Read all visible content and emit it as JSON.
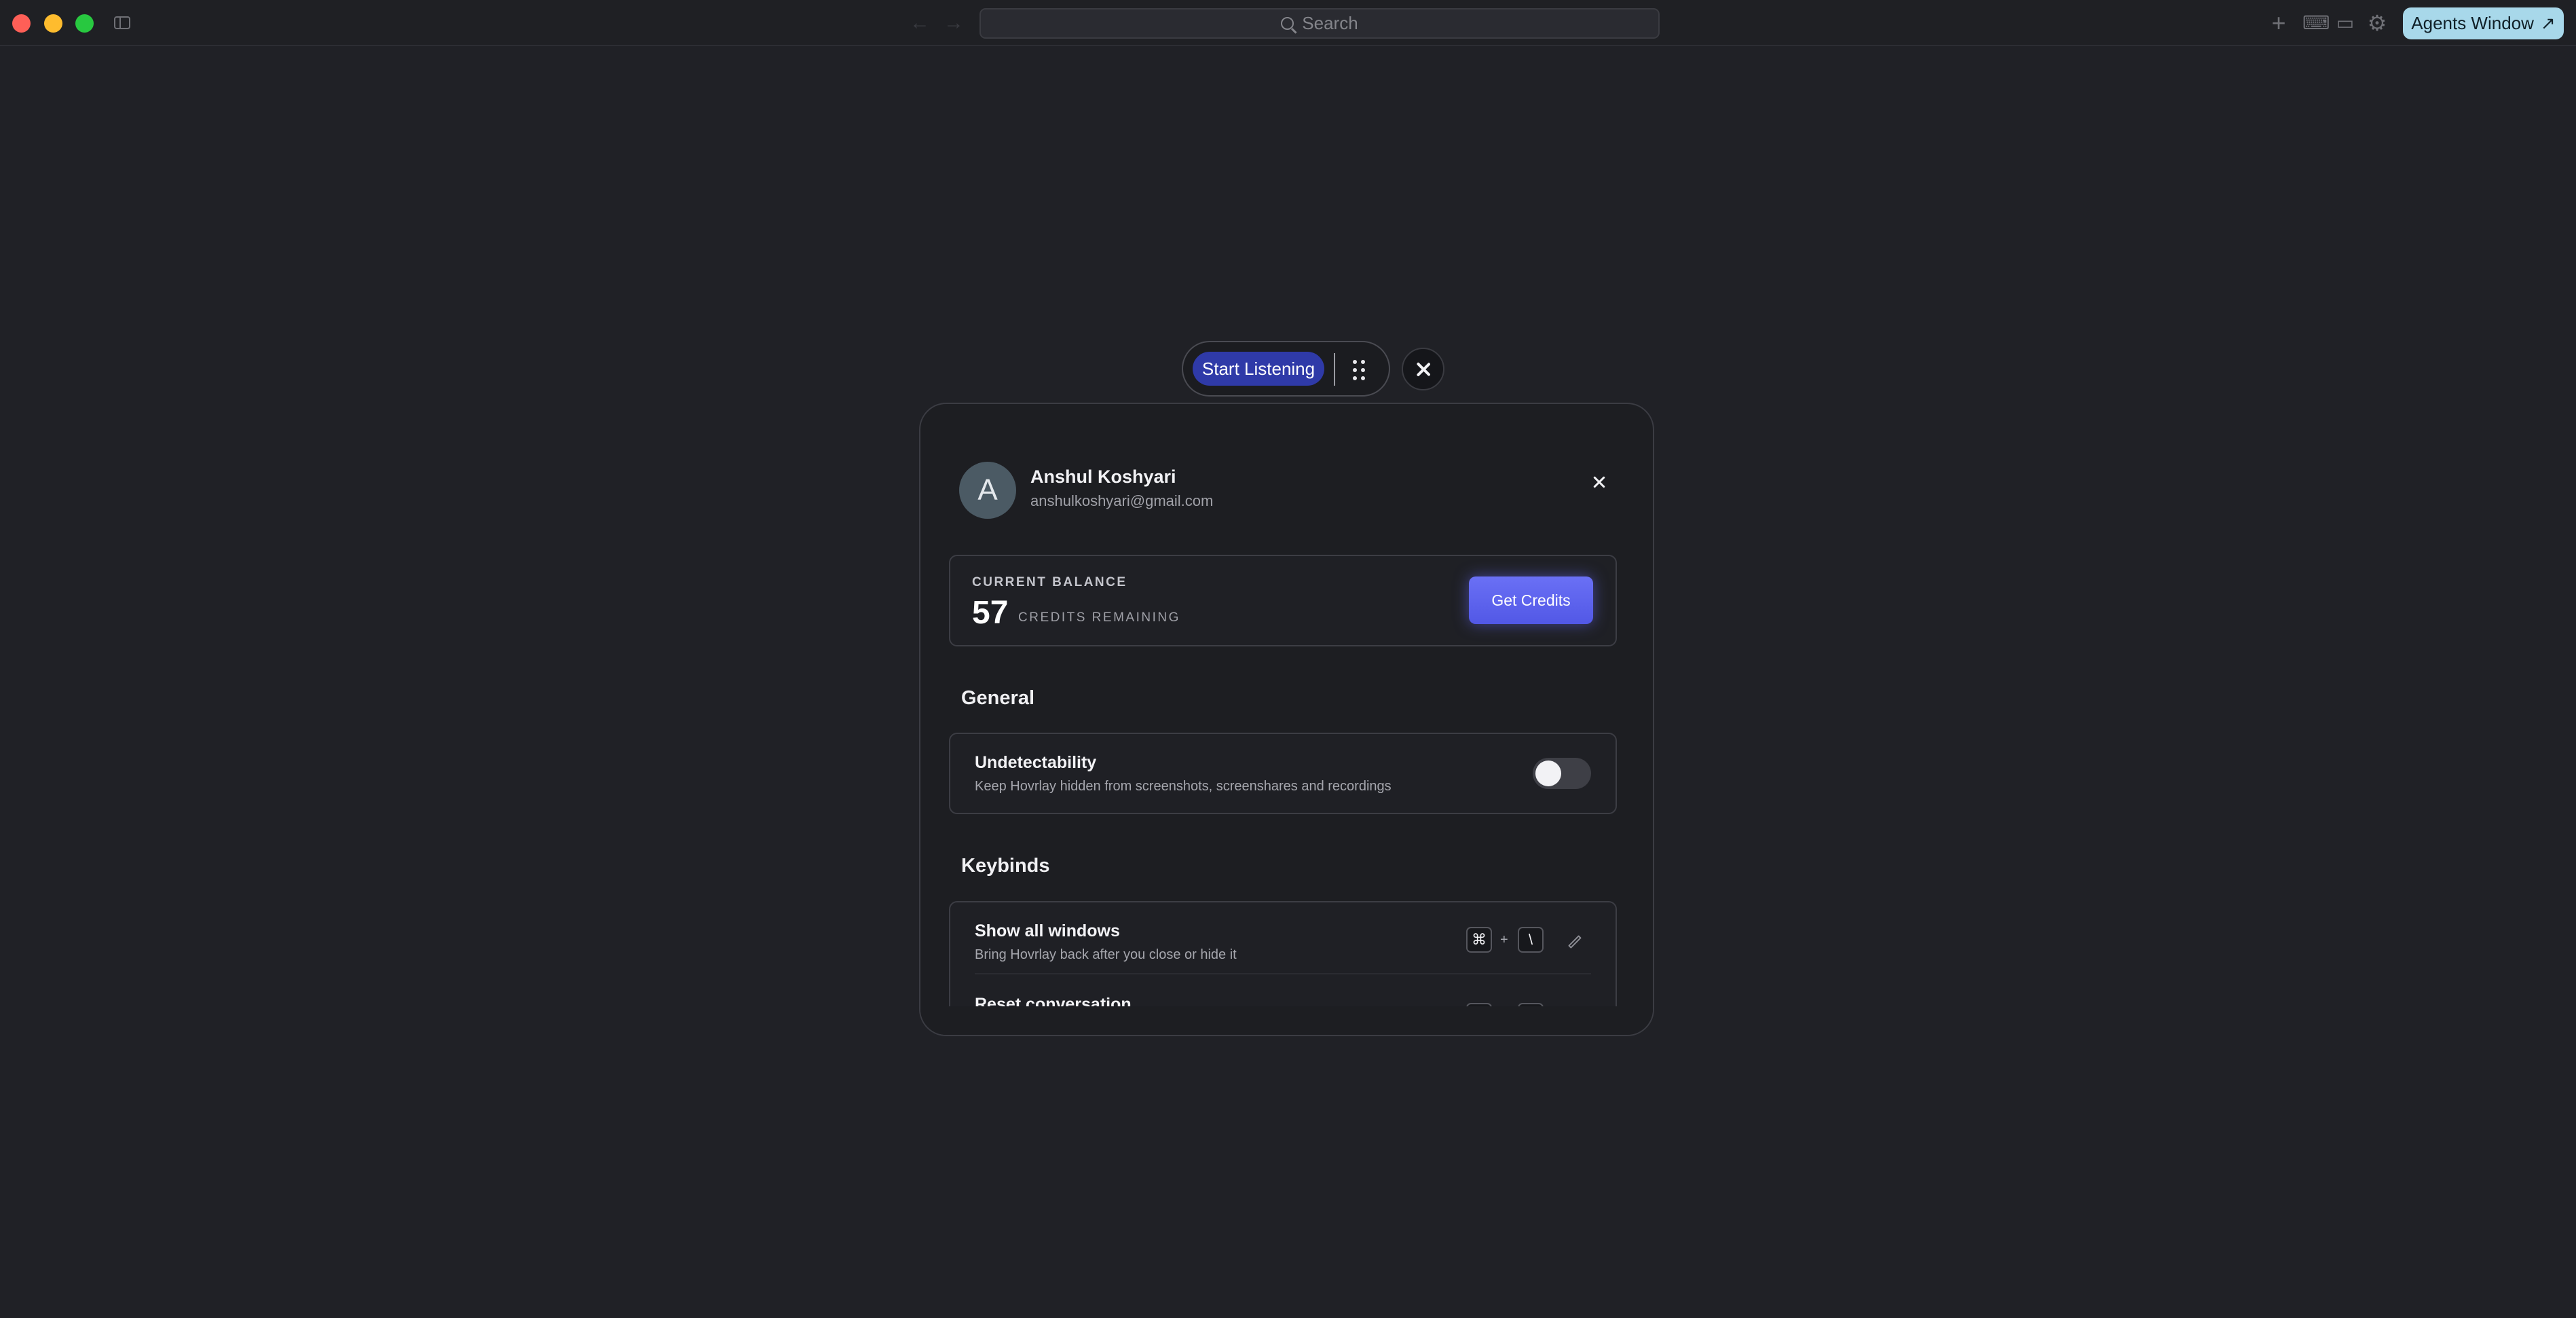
{
  "titlebar": {
    "search_placeholder": "Search",
    "agents_window_label": "Agents Window",
    "agents_window_icon": "↗",
    "icons": [
      "plus-icon",
      "keyboard-icon",
      "chat-icon",
      "gear-icon"
    ]
  },
  "pill": {
    "listen_label": "Start Listening"
  },
  "profile": {
    "avatar_letter": "A",
    "name": "Anshul Koshyari",
    "email": "anshulkoshyari@gmail.com"
  },
  "balance": {
    "label": "CURRENT BALANCE",
    "value": "57",
    "unit": "CREDITS REMAINING",
    "get_credits_label": "Get Credits"
  },
  "general": {
    "title": "General",
    "undetectability": {
      "title": "Undetectability",
      "description": "Keep Hovrlay hidden from screenshots, screenshares and recordings",
      "enabled": false
    }
  },
  "keybinds": {
    "title": "Keybinds",
    "items": [
      {
        "title": "Show all windows",
        "description": "Bring Hovrlay back after you close or hide it",
        "keys": [
          "⌘",
          "\\"
        ],
        "separator": "+"
      },
      {
        "title": "Reset conversation",
        "description": "",
        "keys": [
          "",
          ""
        ],
        "separator": "+"
      }
    ]
  },
  "colors": {
    "background": "#202126",
    "accent": "#5b61ee",
    "listen_button": "#2f3aa8",
    "agents_button": "#a8d8ea"
  }
}
